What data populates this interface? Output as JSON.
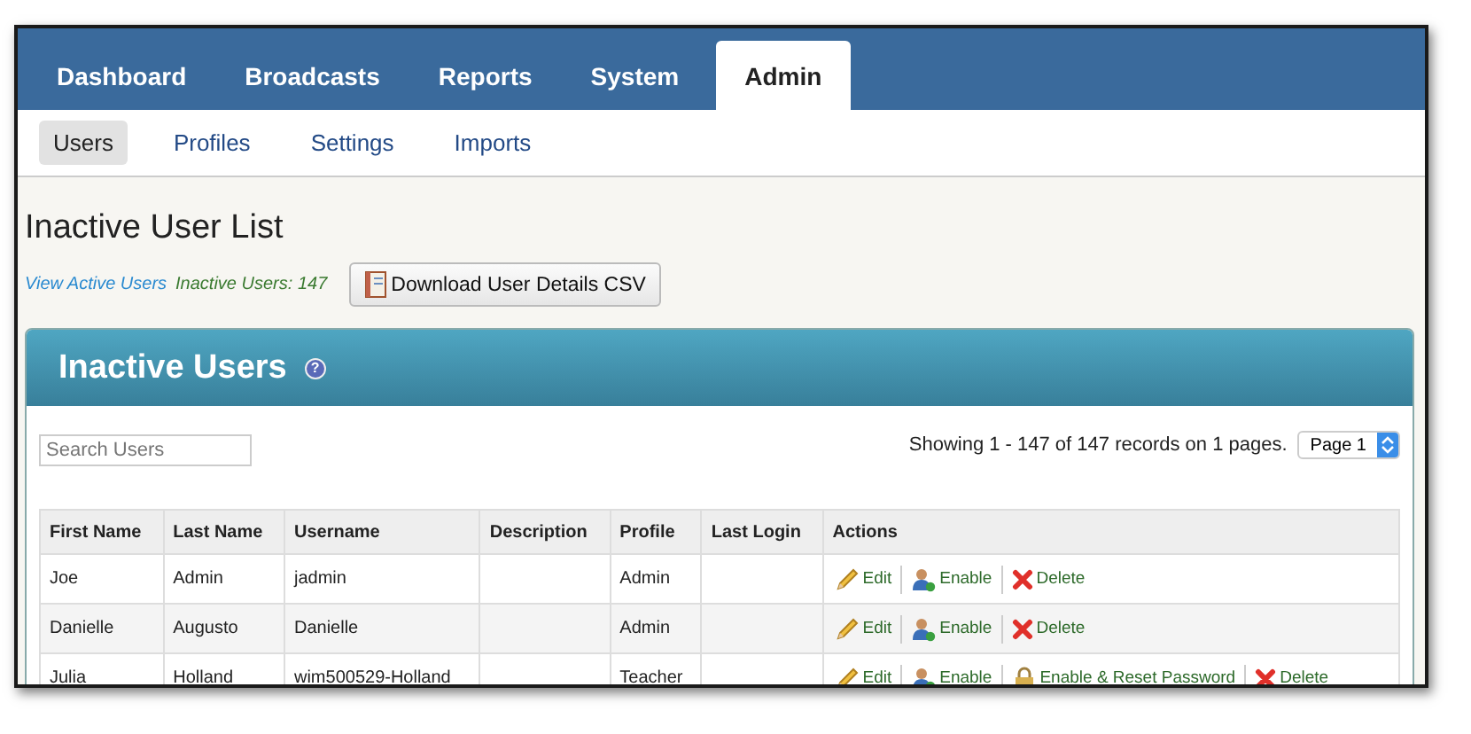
{
  "nav_tabs": [
    {
      "label": "Dashboard",
      "selected": false
    },
    {
      "label": "Broadcasts",
      "selected": false
    },
    {
      "label": "Reports",
      "selected": false
    },
    {
      "label": "System",
      "selected": false
    },
    {
      "label": "Admin",
      "selected": true
    }
  ],
  "sub_tabs": [
    {
      "label": "Users",
      "selected": true
    },
    {
      "label": "Profiles",
      "selected": false
    },
    {
      "label": "Settings",
      "selected": false
    },
    {
      "label": "Imports",
      "selected": false
    }
  ],
  "page_title": "Inactive User List",
  "view_active_link": "View Active Users",
  "inactive_count": "Inactive Users: 147",
  "download_button": "Download User Details CSV",
  "panel": {
    "title": "Inactive Users",
    "help_icon": "?",
    "search": {
      "placeholder": "Search Users"
    },
    "records_summary": "Showing 1 - 147 of 147 records on 1 pages.",
    "page_select": "Page 1",
    "table": {
      "columns": [
        "First Name",
        "Last Name",
        "Username",
        "Description",
        "Profile",
        "Last Login",
        "Actions"
      ],
      "rows": [
        {
          "cells": [
            "Joe",
            "Admin",
            "jadmin",
            "",
            "Admin",
            ""
          ],
          "actions": [
            {
              "kind": "edit",
              "label": "Edit"
            },
            {
              "kind": "enable",
              "label": "Enable"
            },
            {
              "kind": "delete",
              "label": "Delete"
            }
          ]
        },
        {
          "cells": [
            "Danielle",
            "Augusto",
            "Danielle",
            "",
            "Admin",
            ""
          ],
          "actions": [
            {
              "kind": "edit",
              "label": "Edit"
            },
            {
              "kind": "enable",
              "label": "Enable"
            },
            {
              "kind": "delete",
              "label": "Delete"
            }
          ]
        },
        {
          "cells": [
            "Julia",
            "Holland",
            "wim500529-Holland",
            "",
            "Teacher",
            ""
          ],
          "actions": [
            {
              "kind": "edit",
              "label": "Edit"
            },
            {
              "kind": "enable",
              "label": "Enable"
            },
            {
              "kind": "reset",
              "label": "Enable & Reset Password"
            },
            {
              "kind": "delete",
              "label": "Delete"
            }
          ]
        }
      ]
    }
  }
}
